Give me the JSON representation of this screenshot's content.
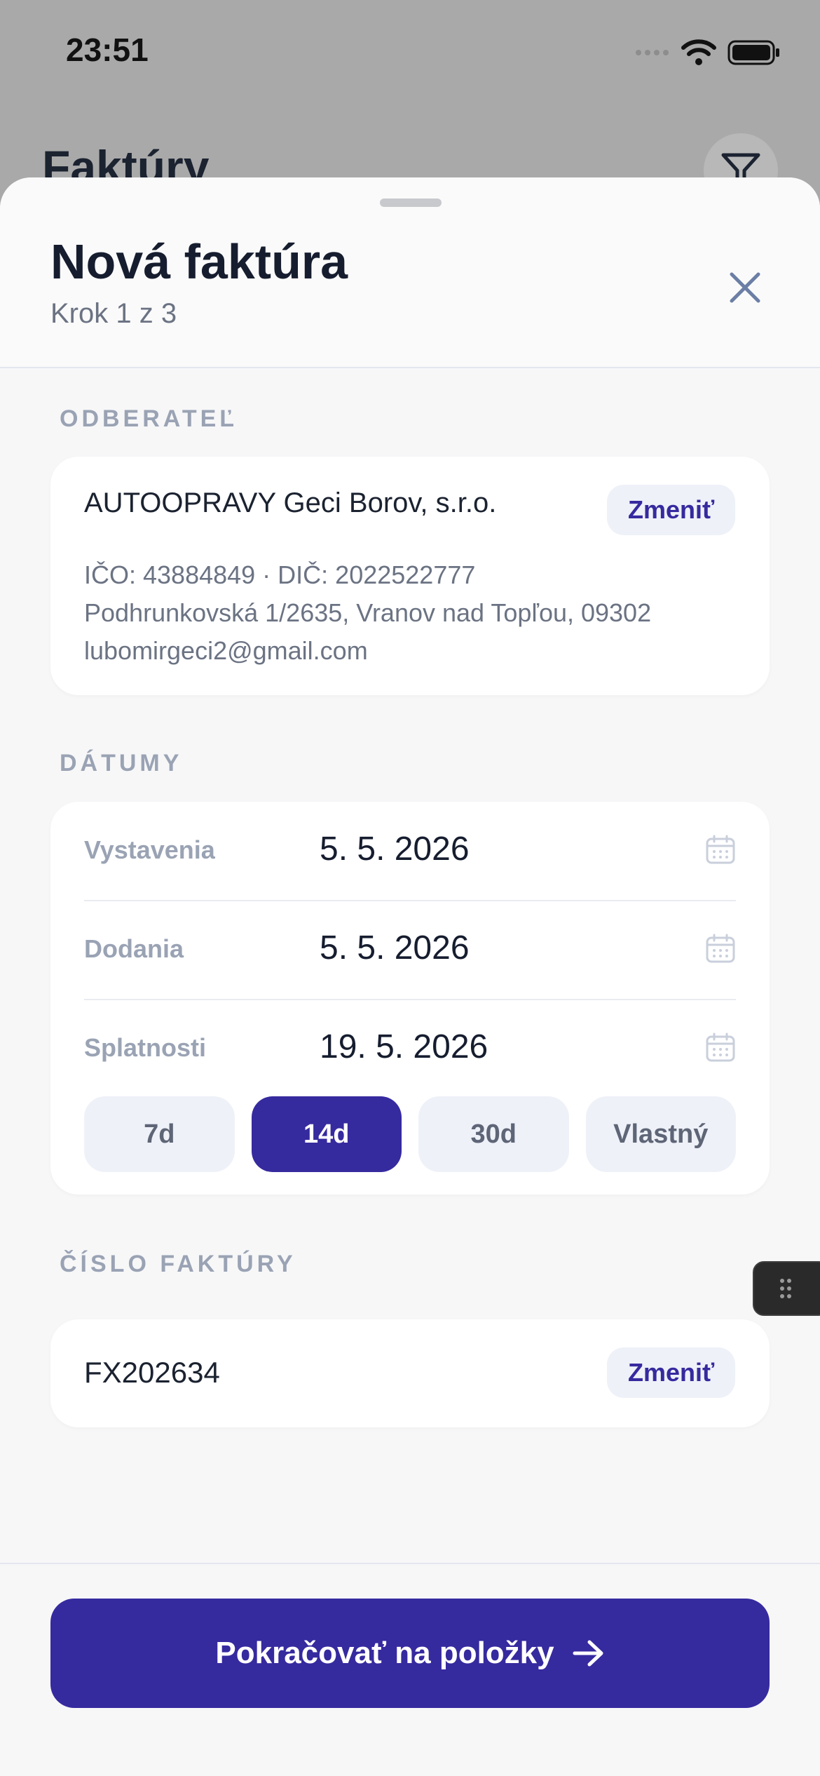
{
  "status_bar": {
    "time": "23:51"
  },
  "background": {
    "title": "Faktúry",
    "filter_icon": "filter-icon"
  },
  "sheet": {
    "title": "Nová faktúra",
    "step": "Krok 1 z 3",
    "close_icon": "close-icon"
  },
  "customer": {
    "section_label": "ODBERATEĽ",
    "name": "AUTOOPRAVY Geci Borov, s.r.o.",
    "change_label": "Zmeniť",
    "ids_line": "IČO: 43884849  ·  DIČ: 2022522777",
    "address": "Podhrunkovská 1/2635, Vranov nad Topľou, 09302",
    "email": "lubomirgeci2@gmail.com"
  },
  "dates": {
    "section_label": "DÁTUMY",
    "rows": [
      {
        "label": "Vystavenia",
        "value": "5. 5. 2026"
      },
      {
        "label": "Dodania",
        "value": "5. 5. 2026"
      },
      {
        "label": "Splatnosti",
        "value": "19. 5. 2026"
      }
    ],
    "due_options": [
      "7d",
      "14d",
      "30d",
      "Vlastný"
    ],
    "selected_due_option": "14d"
  },
  "invoice_number": {
    "section_label": "ČÍSLO FAKTÚRY",
    "value": "FX202634",
    "change_label": "Zmeniť"
  },
  "footer": {
    "continue_label": "Pokračovať na položky"
  },
  "colors": {
    "accent": "#362a9f",
    "muted": "#9aa3b4",
    "chip_bg": "#eef1f8"
  }
}
